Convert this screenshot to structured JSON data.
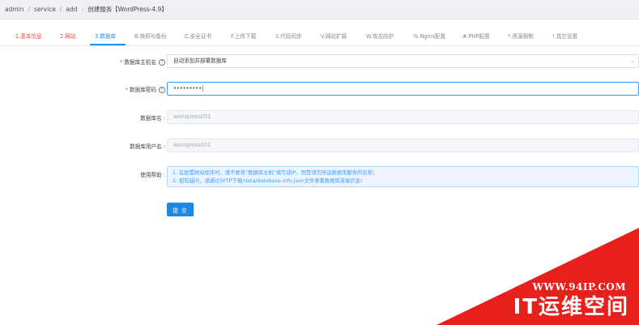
{
  "breadcrumb": {
    "items": [
      "admin",
      "service",
      "add",
      "创建服务【WordPress-4.9】"
    ]
  },
  "tabs": [
    {
      "label": "1.基本信息",
      "state": "red"
    },
    {
      "label": "2.网站",
      "state": "red"
    },
    {
      "label": "3.数据库",
      "state": "active"
    },
    {
      "label": "B.快照与备份",
      "state": "normal"
    },
    {
      "label": "C.安全证书",
      "state": "normal"
    },
    {
      "label": "F.上传下载",
      "state": "normal"
    },
    {
      "label": "S.代码同步",
      "state": "normal"
    },
    {
      "label": "V.网站扩展",
      "state": "normal"
    },
    {
      "label": "W.攻击防护",
      "state": "normal"
    },
    {
      "label": "%.Ngins配置",
      "state": "normal"
    },
    {
      "label": "#.PHP配置",
      "state": "normal"
    },
    {
      "label": "*.资源限制",
      "state": "normal"
    },
    {
      "label": "!.其它设置",
      "state": "normal"
    }
  ],
  "form": {
    "db_host": {
      "label": "数据库主机名",
      "value": "自动添加并部署数据库"
    },
    "db_password": {
      "label": "数据库密码",
      "value": "•••••••••"
    },
    "db_name": {
      "label": "数据库名 :",
      "value": "wordpress001"
    },
    "db_user": {
      "label": "数据库用户名 :",
      "value": "wordpress001"
    },
    "help": {
      "label": "使用帮助 :",
      "line1": "1. 在配置网站程序时，请不要将“数据库主机”填写成IP，而是填写所选数据库服务的名称；",
      "line2": "2. 如有疑问，请通过SFTP下载/data/database-info.json文件查看数据库连接信息!"
    },
    "submit_label": "提 交"
  },
  "watermark": {
    "url": "WWW.94IP.COM",
    "brand": "IT运维空间"
  },
  "colors": {
    "accent": "#1890ff",
    "required": "#e4493a",
    "watermark_red": "#e8201c"
  }
}
